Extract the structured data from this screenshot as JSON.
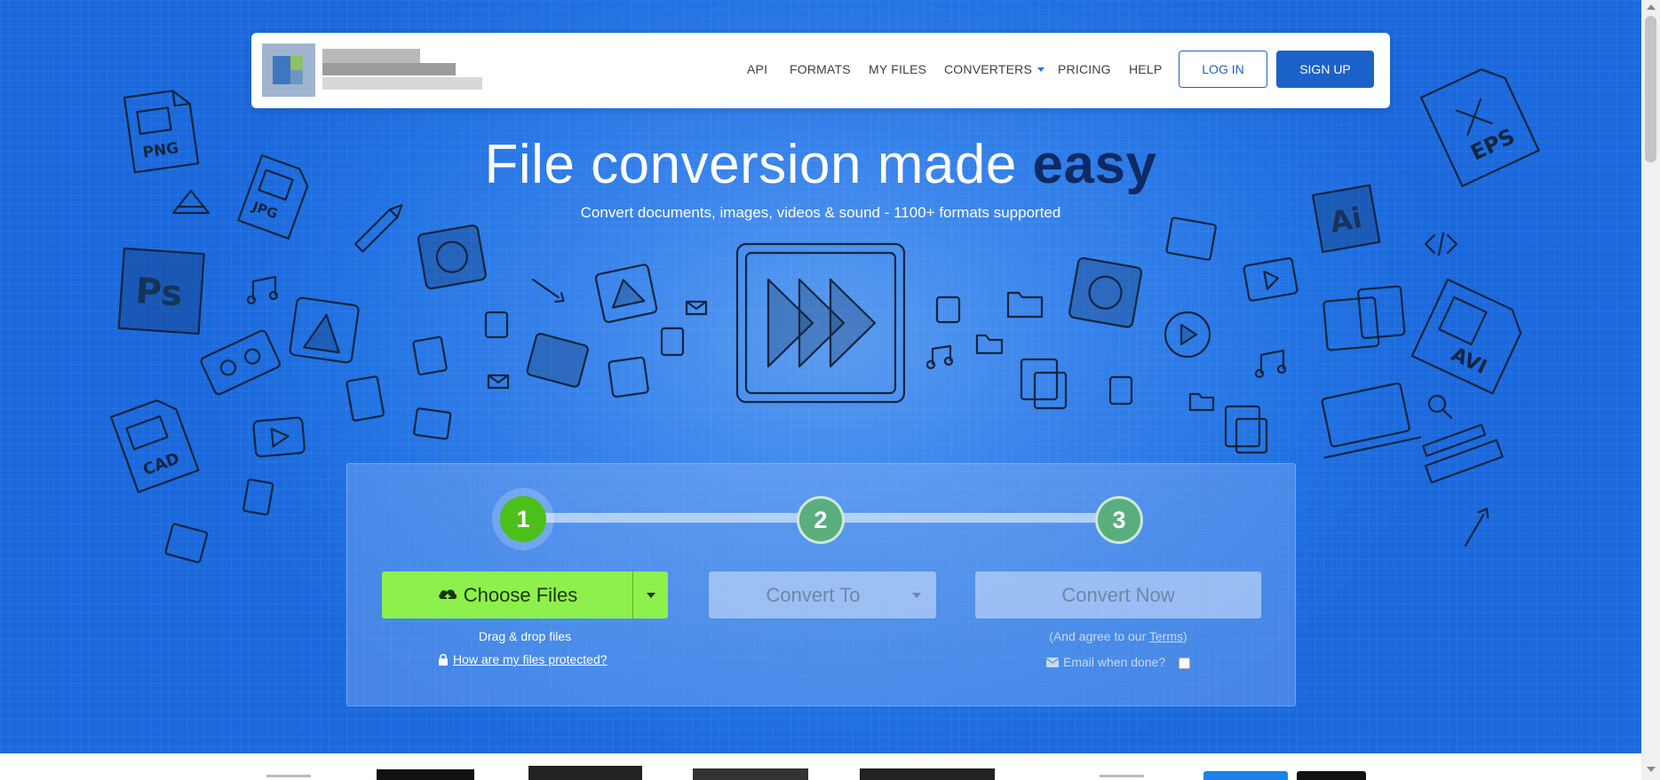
{
  "nav": {
    "links": [
      "API",
      "FORMATS",
      "MY FILES",
      "CONVERTERS",
      "PRICING",
      "HELP"
    ],
    "login": "LOG IN",
    "signup": "SIGN UP"
  },
  "hero": {
    "headline_main": "File conversion made ",
    "headline_strong": "easy",
    "subheadline": "Convert documents, images, videos & sound - 1100+ formats supported",
    "doodle_labels": [
      "PNG",
      "JPG",
      "Ps",
      "CAD",
      "EPS",
      "Ai",
      "AVI"
    ]
  },
  "converter": {
    "steps": [
      "1",
      "2",
      "3"
    ],
    "choose_files": "Choose Files",
    "convert_to": "Convert To",
    "convert_now": "Convert Now",
    "drag_drop": "Drag & drop files",
    "protected_link": "How are my files protected?",
    "agree_prefix": "(And agree to our ",
    "terms": "Terms",
    "agree_suffix": ")",
    "email_label": "Email when done?"
  },
  "colors": {
    "primary": "#1a62c7",
    "step_active": "#4bbf1a",
    "choose_bg": "#8ef04a",
    "headline_accent": "#0e2a63"
  }
}
